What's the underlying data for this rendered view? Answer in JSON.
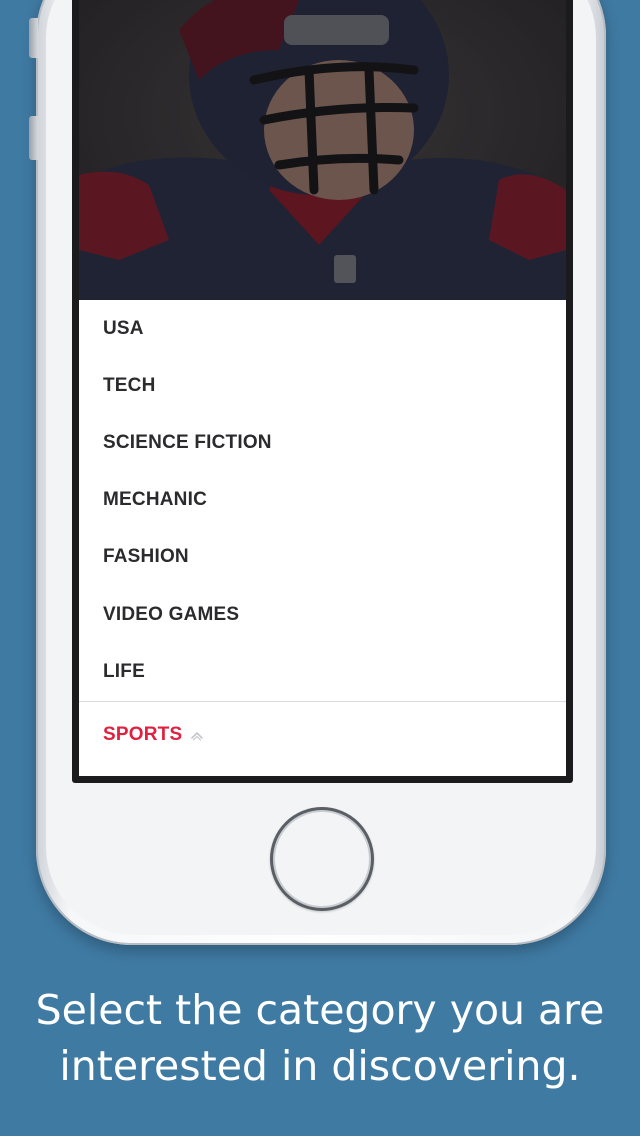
{
  "menu": {
    "items": [
      {
        "label": "USA"
      },
      {
        "label": "TECH"
      },
      {
        "label": "SCIENCE FICTION"
      },
      {
        "label": "MECHANIC"
      },
      {
        "label": "FASHION"
      },
      {
        "label": "VIDEO GAMES"
      },
      {
        "label": "LIFE"
      }
    ],
    "selected": {
      "label": "SPORTS",
      "icon": "chevron-up-icon"
    }
  },
  "caption": {
    "line1": "Select the category you are",
    "line2": "interested in discovering."
  },
  "colors": {
    "background": "#3f7aa3",
    "accent": "#e0203f",
    "menu_text": "#2b2b2e"
  }
}
